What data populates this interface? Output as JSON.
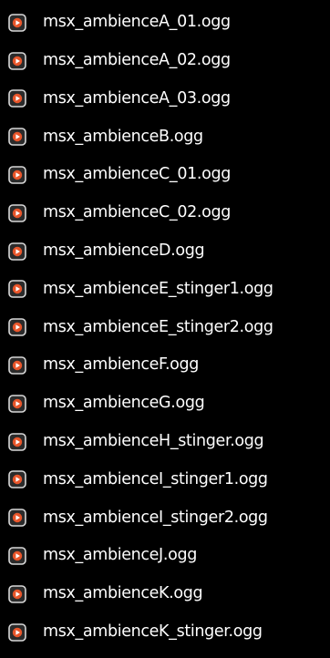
{
  "file_icon": "media-file-icon",
  "colors": {
    "background": "#000000",
    "text": "#ffffff",
    "icon_base": "#2b2b2b",
    "icon_accent": "#e8552a"
  },
  "files": [
    {
      "name": "msx_ambienceA_01.ogg"
    },
    {
      "name": "msx_ambienceA_02.ogg"
    },
    {
      "name": "msx_ambienceA_03.ogg"
    },
    {
      "name": "msx_ambienceB.ogg"
    },
    {
      "name": "msx_ambienceC_01.ogg"
    },
    {
      "name": "msx_ambienceC_02.ogg"
    },
    {
      "name": "msx_ambienceD.ogg"
    },
    {
      "name": "msx_ambienceE_stinger1.ogg"
    },
    {
      "name": "msx_ambienceE_stinger2.ogg"
    },
    {
      "name": "msx_ambienceF.ogg"
    },
    {
      "name": "msx_ambienceG.ogg"
    },
    {
      "name": "msx_ambienceH_stinger.ogg"
    },
    {
      "name": "msx_ambienceI_stinger1.ogg"
    },
    {
      "name": "msx_ambienceI_stinger2.ogg"
    },
    {
      "name": "msx_ambienceJ.ogg"
    },
    {
      "name": "msx_ambienceK.ogg"
    },
    {
      "name": "msx_ambienceK_stinger.ogg"
    }
  ]
}
